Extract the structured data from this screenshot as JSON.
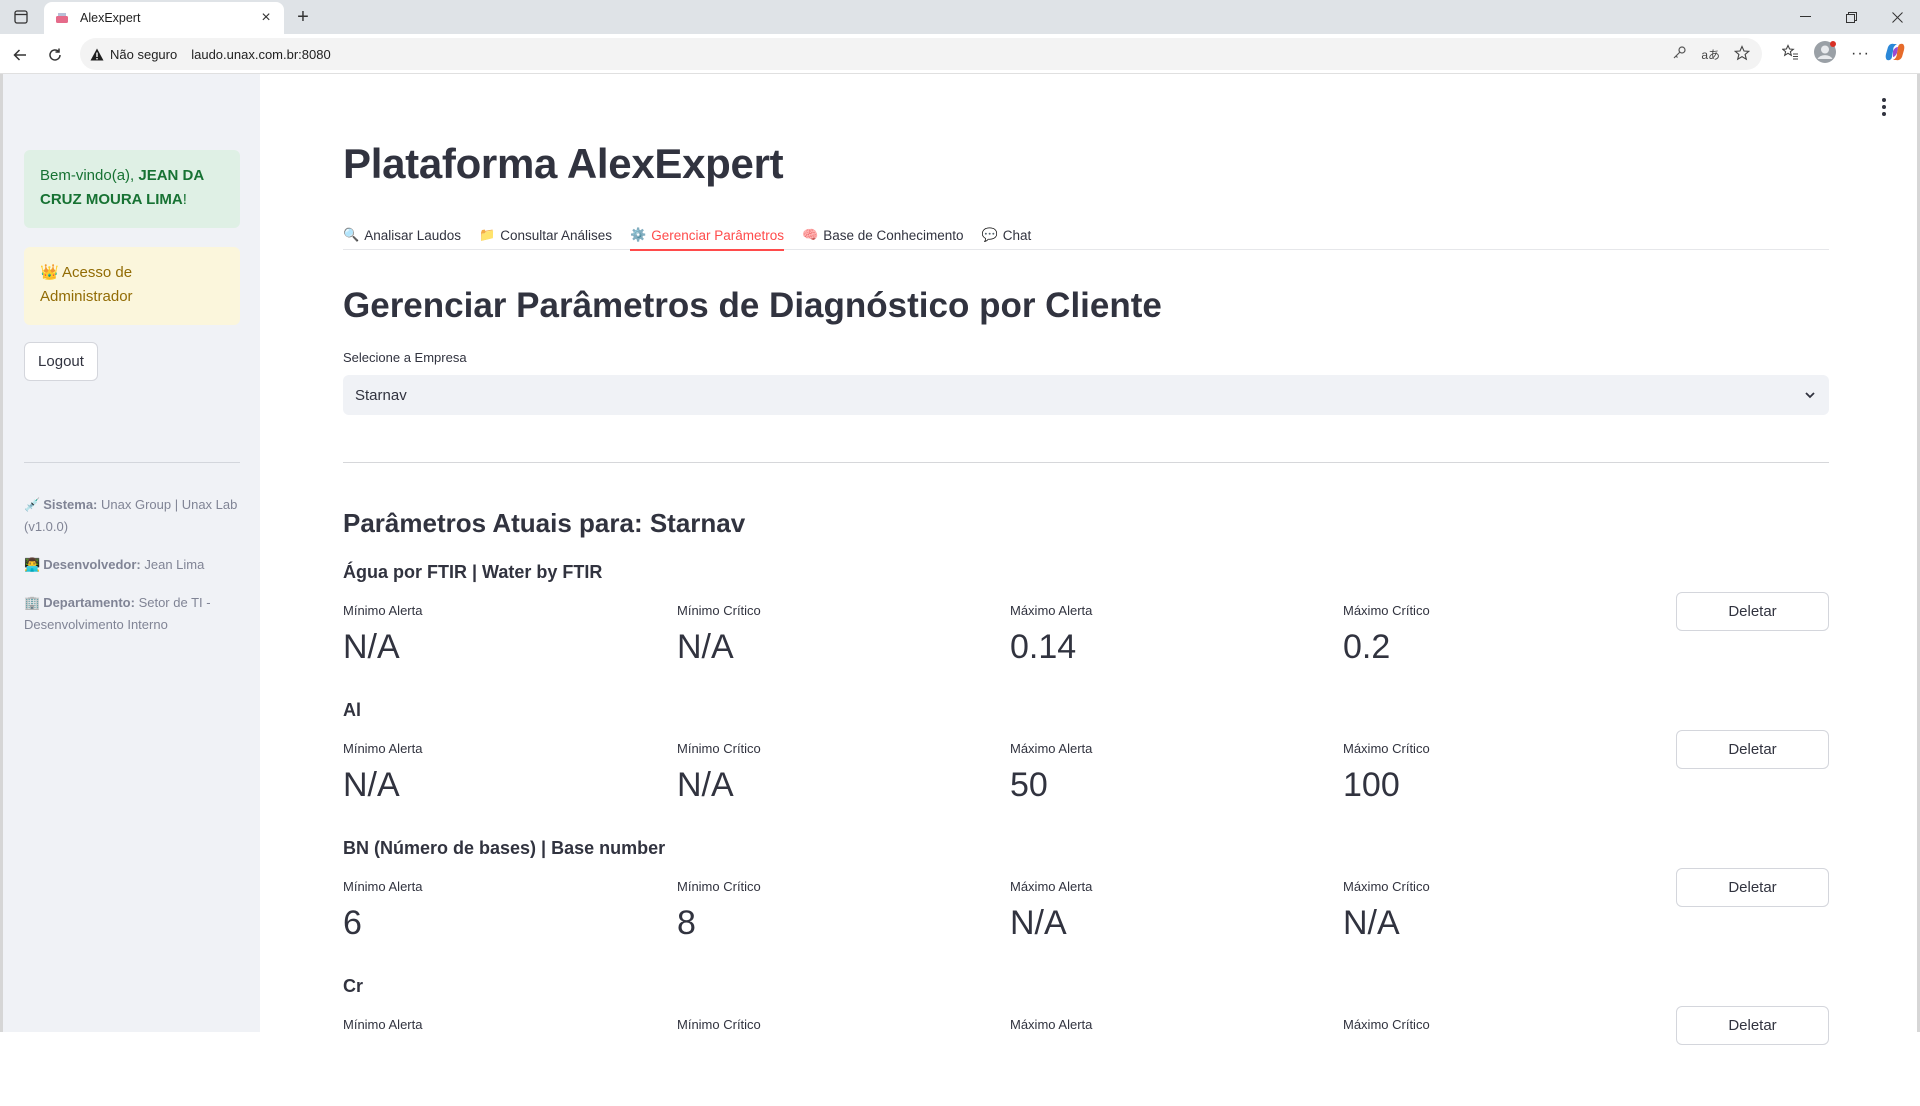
{
  "browser": {
    "tab_title": "AlexExpert",
    "insecure_label": "Não seguro",
    "url": "laudo.unax.com.br:8080"
  },
  "sidebar": {
    "welcome_prefix": "Bem-vindo(a), ",
    "welcome_name": "JEAN DA CRUZ MOURA LIMA",
    "welcome_suffix": "!",
    "admin_icon": "👑",
    "admin_text": "Acesso de Administrador",
    "logout_label": "Logout",
    "info": [
      {
        "icon": "💉",
        "label": "Sistema:",
        "value": "Unax Group | Unax Lab (v1.0.0)"
      },
      {
        "icon": "👨‍💻",
        "label": "Desenvolvedor:",
        "value": "Jean Lima"
      },
      {
        "icon": "🏢",
        "label": "Departamento:",
        "value": "Setor de TI - Desenvolvimento Interno"
      }
    ]
  },
  "main": {
    "title": "Plataforma AlexExpert",
    "tabs": [
      {
        "icon": "🔍",
        "label": "Analisar Laudos",
        "active": false
      },
      {
        "icon": "📁",
        "label": "Consultar Análises",
        "active": false
      },
      {
        "icon": "⚙️",
        "label": "Gerenciar Parâmetros",
        "active": true
      },
      {
        "icon": "🧠",
        "label": "Base de Conhecimento",
        "active": false
      },
      {
        "icon": "💬",
        "label": "Chat",
        "active": false
      }
    ],
    "section_title": "Gerenciar Parâmetros de Diagnóstico por Cliente",
    "select_label": "Selecione a Empresa",
    "select_value": "Starnav",
    "params_title": "Parâmetros Atuais para: Starnav",
    "metric_labels": [
      "Mínimo Alerta",
      "Mínimo Crítico",
      "Máximo Alerta",
      "Máximo Crítico"
    ],
    "delete_label": "Deletar",
    "params": [
      {
        "name": "Água por FTIR | Water by FTIR",
        "values": [
          "N/A",
          "N/A",
          "0.14",
          "0.2"
        ]
      },
      {
        "name": "Al",
        "values": [
          "N/A",
          "N/A",
          "50",
          "100"
        ]
      },
      {
        "name": "BN (Número de bases) | Base number",
        "values": [
          "6",
          "8",
          "N/A",
          "N/A"
        ]
      },
      {
        "name": "Cr",
        "values": [
          "",
          "",
          "",
          ""
        ]
      }
    ]
  }
}
